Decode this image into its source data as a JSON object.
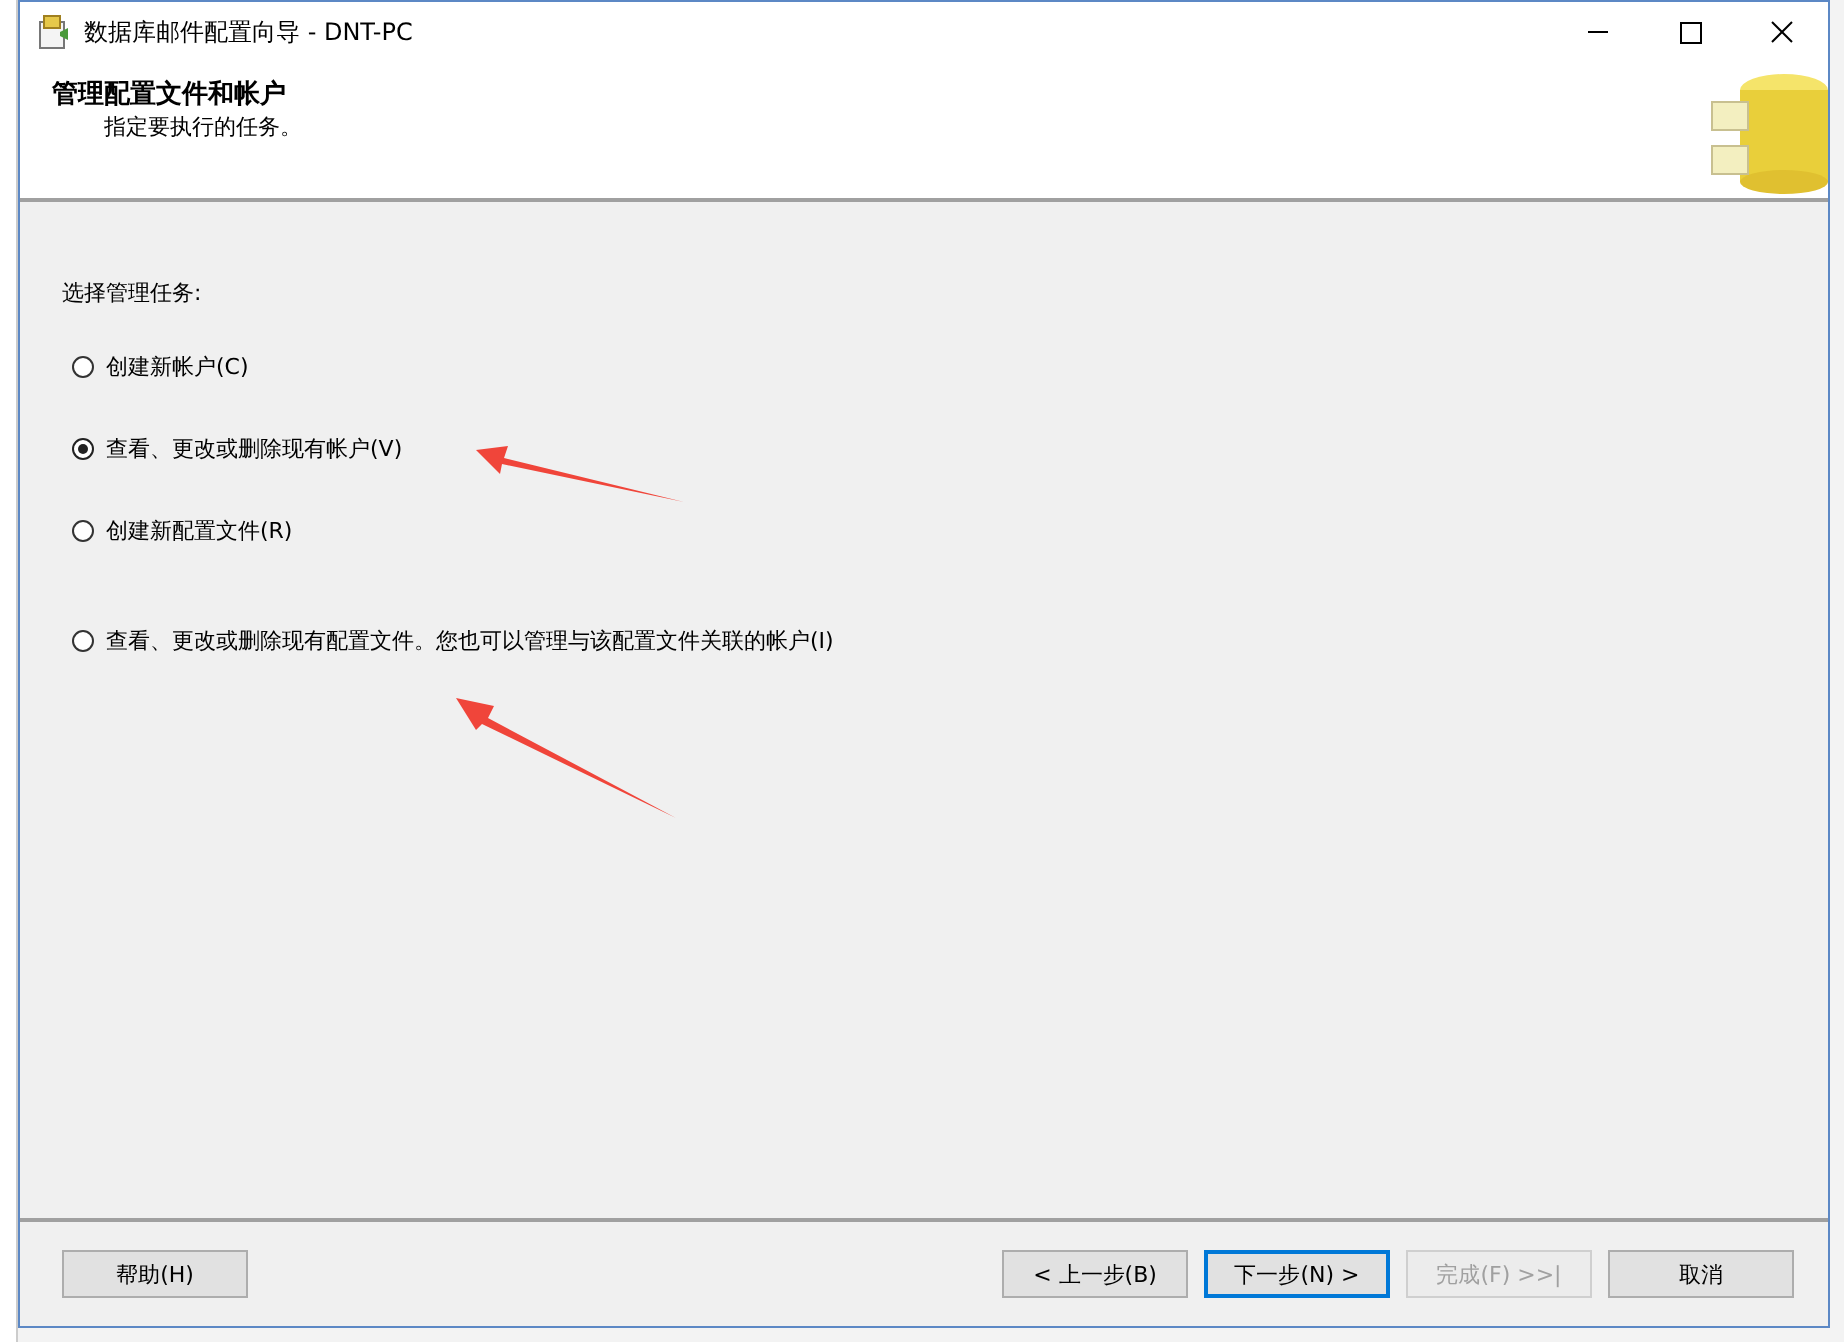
{
  "window": {
    "title": "数据库邮件配置向导 - DNT-PC"
  },
  "header": {
    "title": "管理配置文件和帐户",
    "subtitle": "指定要执行的任务。"
  },
  "prompt": "选择管理任务:",
  "options": [
    {
      "label": "创建新帐户(C)",
      "selected": false
    },
    {
      "label": "查看、更改或删除现有帐户(V)",
      "selected": true
    },
    {
      "label": "创建新配置文件(R)",
      "selected": false
    },
    {
      "label": "查看、更改或删除现有配置文件。您也可以管理与该配置文件关联的帐户(I)",
      "selected": false
    }
  ],
  "buttons": [
    {
      "label": "帮助(H)",
      "kind": "help",
      "disabled": false,
      "focused": false
    },
    {
      "label": "< 上一步(B)",
      "kind": "nav",
      "disabled": false,
      "focused": false
    },
    {
      "label": "下一步(N) >",
      "kind": "nav",
      "disabled": false,
      "focused": true
    },
    {
      "label": "完成(F) >>|",
      "kind": "nav",
      "disabled": true,
      "focused": false
    },
    {
      "label": "取消",
      "kind": "nav",
      "disabled": false,
      "focused": false
    }
  ]
}
